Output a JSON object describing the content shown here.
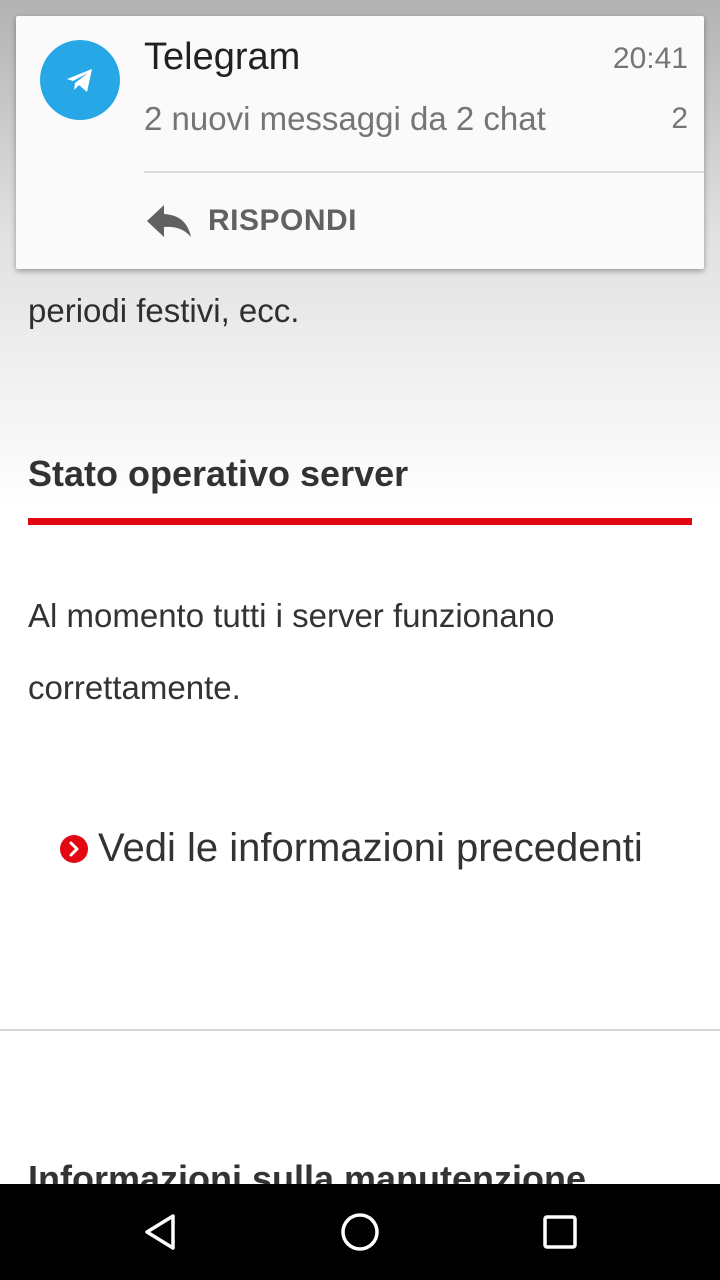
{
  "notification": {
    "app_name": "Telegram",
    "time": "20:41",
    "message": "2 nuovi messaggi da 2 chat",
    "count": "2",
    "action_label": "RISPONDI",
    "icon": "telegram-icon",
    "accent_color": "#27a7e5"
  },
  "page": {
    "previous_text_fragment": "periodi festivi, ecc.",
    "section_title": "Stato operativo server",
    "section_rule_color": "#e30613",
    "status_text": "Al momento tutti i server funzionano correttamente.",
    "previous_info_link": "Vedi le informazioni precedenti",
    "next_section_title": "Informazioni sulla manutenzione"
  },
  "navbar": {
    "back_icon": "back-triangle-icon",
    "home_icon": "home-circle-icon",
    "recents_icon": "recents-square-icon"
  }
}
